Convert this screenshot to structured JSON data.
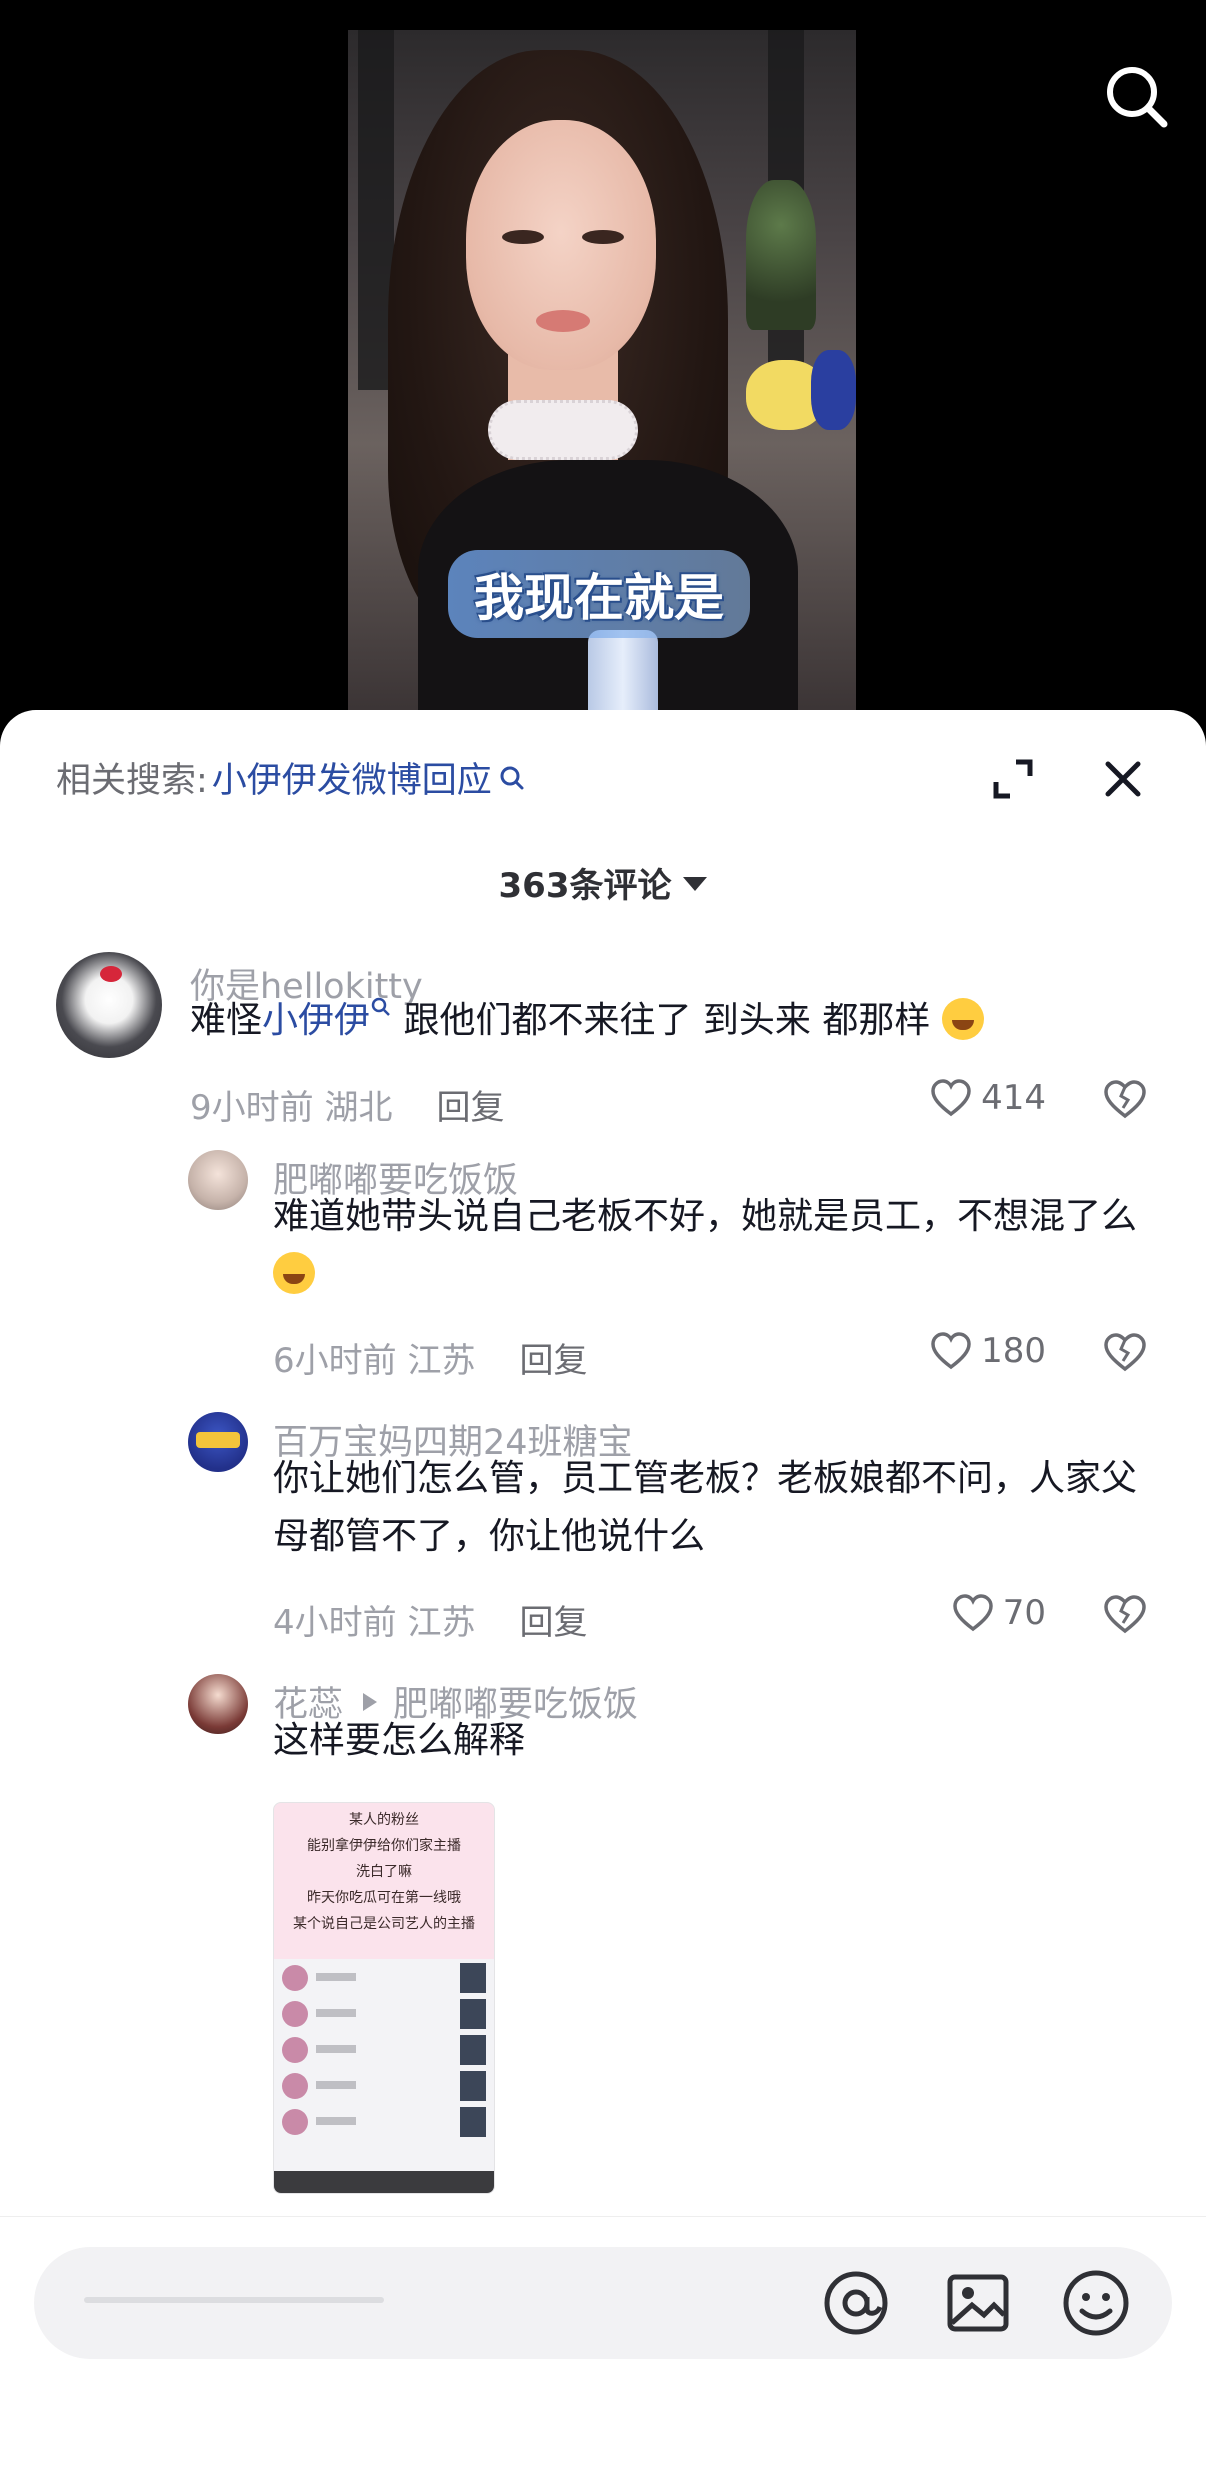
{
  "video": {
    "caption": "我现在就是"
  },
  "panel": {
    "related_label": "相关搜索:",
    "related_query": "小伊伊发微博回应",
    "comment_count": "363条评论"
  },
  "comments": [
    {
      "username": "你是hellokitty",
      "text_before": "难怪",
      "mention": "小伊伊",
      "text_after": "跟他们都不来往了 到头来 都那样",
      "time": "9小时前",
      "location": "湖北",
      "reply_label": "回复",
      "likes": "414"
    },
    {
      "username": "肥嘟嘟要吃饭饭",
      "text": "难道她带头说自己老板不好，她就是员工，不想混了么",
      "time": "6小时前",
      "location": "江苏",
      "reply_label": "回复",
      "likes": "180"
    },
    {
      "username": "百万宝妈四期24班糖宝",
      "text": "你让她们怎么管，员工管老板？老板娘都不问，人家父母都管不了，你让他说什么",
      "time": "4小时前",
      "location": "江苏",
      "reply_label": "回复",
      "likes": "70"
    },
    {
      "username": "花蕊",
      "reply_to": "肥嘟嘟要吃饭饭",
      "text": "这样要怎么解释"
    }
  ],
  "shared_image": {
    "lines": [
      "某人的粉丝",
      "能别拿伊伊给你们家主播",
      "洗白了嘛",
      "昨天你吃瓜可在第一线哦",
      "某个说自己是公司艺人的主播"
    ]
  },
  "icons": {
    "search": "search-icon",
    "expand": "expand-icon",
    "close": "close-icon",
    "like": "heart-icon",
    "dislike": "broken-heart-icon",
    "mention": "at-icon",
    "image": "image-icon",
    "emoji": "emoji-icon"
  }
}
